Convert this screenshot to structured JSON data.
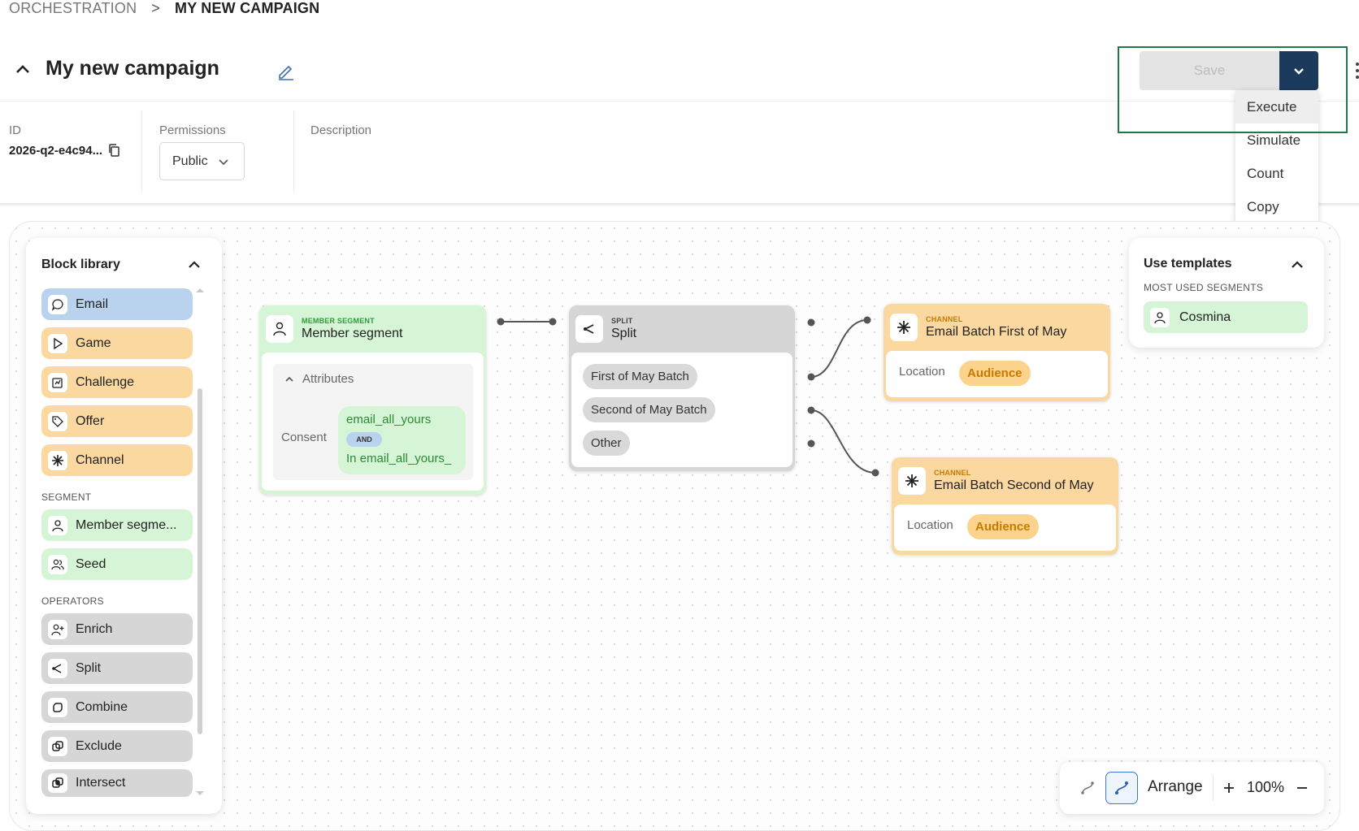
{
  "breadcrumb": {
    "root": "ORCHESTRATION",
    "separator": ">",
    "current": "MY NEW CAMPAIGN"
  },
  "campaign": {
    "title": "My new campaign"
  },
  "meta": {
    "id_label": "ID",
    "id_value": "2026-q2-e4c94...",
    "permissions_label": "Permissions",
    "permissions_value": "Public",
    "description_label": "Description"
  },
  "actions": {
    "save_label": "Save",
    "menu": [
      "Execute",
      "Simulate",
      "Count",
      "Copy"
    ]
  },
  "library": {
    "title": "Block library",
    "items": [
      {
        "label": "Email",
        "color": "#b9d3ee",
        "icon": "chat-bubble-icon"
      },
      {
        "label": "Game",
        "color": "#fad8a0",
        "icon": "play-icon"
      },
      {
        "label": "Challenge",
        "color": "#fad8a0",
        "icon": "challenge-icon"
      },
      {
        "label": "Offer",
        "color": "#fad8a0",
        "icon": "tag-icon"
      },
      {
        "label": "Channel",
        "color": "#fad8a0",
        "icon": "asterisk-icon"
      }
    ],
    "segment_title": "SEGMENT",
    "segment_items": [
      {
        "label": "Member segme...",
        "icon": "person-icon"
      },
      {
        "label": "Seed",
        "icon": "people-icon"
      }
    ],
    "operators_title": "OPERATORS",
    "operator_items": [
      {
        "label": "Enrich",
        "icon": "person-add-icon"
      },
      {
        "label": "Split",
        "icon": "split-icon"
      },
      {
        "label": "Combine",
        "icon": "combine-icon"
      },
      {
        "label": "Exclude",
        "icon": "exclude-icon"
      },
      {
        "label": "Intersect",
        "icon": "intersect-icon"
      }
    ]
  },
  "nodes": {
    "member": {
      "category": "MEMBER SEGMENT",
      "name": "Member segment",
      "attributes_label": "Attributes",
      "consent_label": "Consent",
      "consent_value_1": "email_all_yours",
      "operator": "AND",
      "consent_value_2": "In email_all_yours_"
    },
    "split": {
      "category": "SPLIT",
      "name": "Split",
      "branches": [
        "First of May Batch",
        "Second of May Batch",
        "Other"
      ]
    },
    "channel1": {
      "category": "CHANNEL",
      "name": "Email Batch First of May",
      "location_label": "Location",
      "audience": "Audience"
    },
    "channel2": {
      "category": "CHANNEL",
      "name": "Email Batch Second of May",
      "location_label": "Location",
      "audience": "Audience"
    }
  },
  "templates": {
    "title": "Use templates",
    "subtitle": "MOST USED SEGMENTS",
    "item": "Cosmina"
  },
  "controls": {
    "arrange_label": "Arrange",
    "zoom": "100%"
  },
  "colors": {
    "accent_dark": "#1c3a5c",
    "segment_green": "#d6f5d6",
    "channel_orange": "#fad8a0",
    "email_blue": "#b9d3ee",
    "highlight_green": "#1d7a45"
  }
}
